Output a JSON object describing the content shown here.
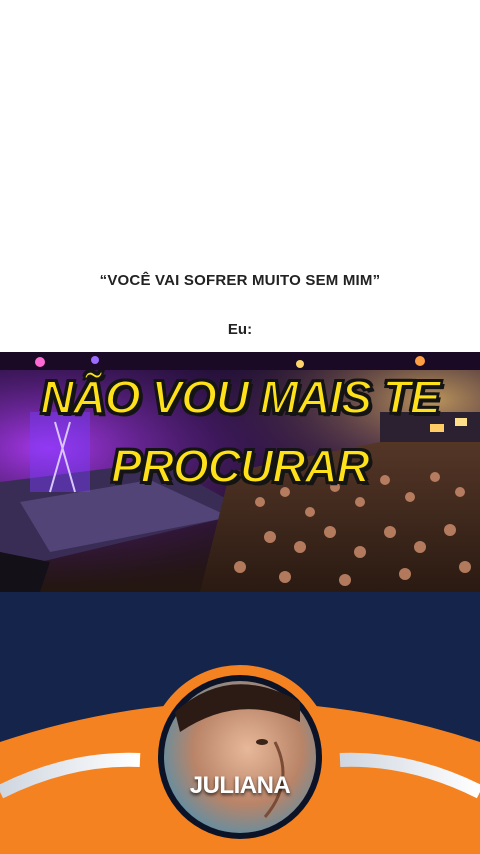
{
  "meme": {
    "quote": "“VOCÊ VAI SOFRER MUITO SEM MIM”",
    "response_label": "Eu:"
  },
  "video": {
    "caption_line1": "NÃO VOU MAIS TE",
    "caption_line2": "PROCURAR"
  },
  "profile": {
    "brand_text": "JULIANA"
  },
  "colors": {
    "caption_fill": "#ffe11a",
    "caption_stroke": "#141414",
    "navy_background": "#14244a",
    "orange_band": "#f58220",
    "avatar_ring": "#0d1326"
  }
}
